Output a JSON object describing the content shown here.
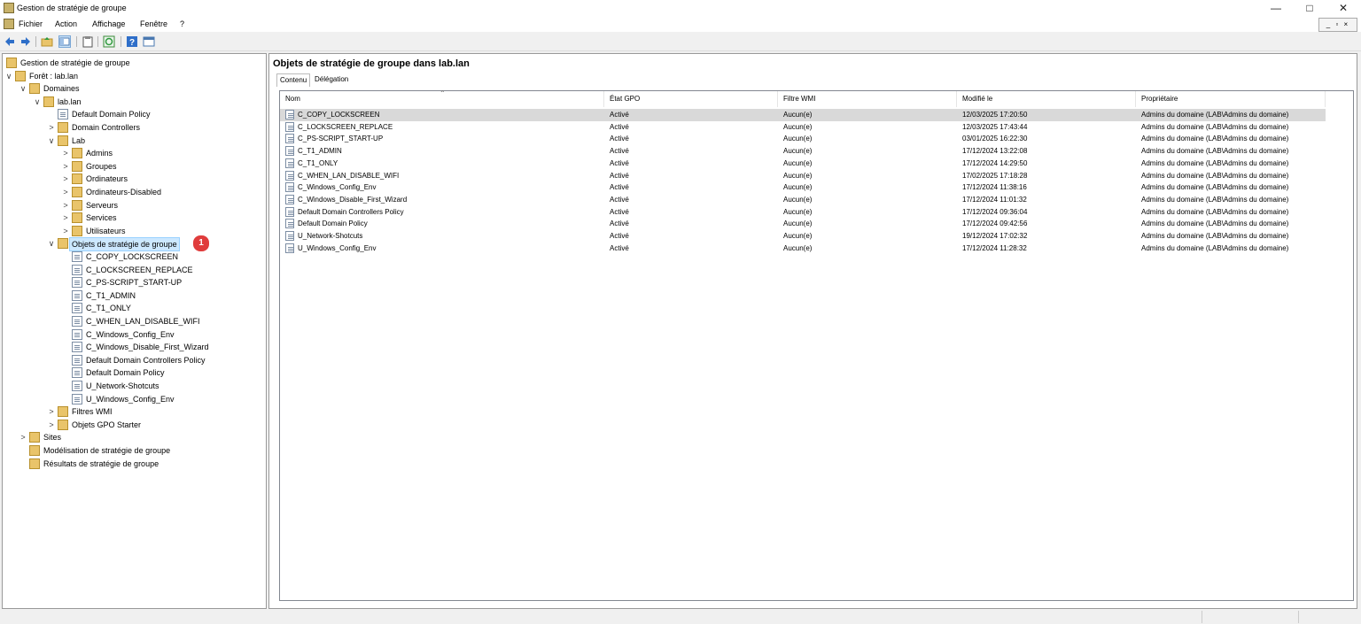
{
  "window": {
    "title": "Gestion de stratégie de groupe",
    "minimize": "—",
    "maximize": "□",
    "close": "✕"
  },
  "menu": [
    "Fichier",
    "Action",
    "Affichage",
    "Fenêtre",
    "?"
  ],
  "mdi_controls": "_ ▫ ×",
  "tree": [
    {
      "label": "Gestion de stratégie de groupe",
      "icon": "gpmc-icon",
      "arrow": ""
    },
    {
      "label": "Forêt : lab.lan",
      "icon": "forest-icon",
      "arrow": "∨"
    },
    {
      "label": "Domaines",
      "icon": "domains-icon",
      "arrow": "∨"
    },
    {
      "label": "lab.lan",
      "icon": "domain-icon",
      "arrow": "∨"
    },
    {
      "label": "Default Domain Policy",
      "icon": "gpo-link-icon",
      "arrow": ""
    },
    {
      "label": "Domain Controllers",
      "icon": "ou-icon",
      "arrow": ">"
    },
    {
      "label": "Lab",
      "icon": "ou-icon",
      "arrow": "∨"
    },
    {
      "label": "Admins",
      "icon": "ou-icon",
      "arrow": ">"
    },
    {
      "label": "Groupes",
      "icon": "ou-icon",
      "arrow": ">"
    },
    {
      "label": "Ordinateurs",
      "icon": "ou-icon",
      "arrow": ">"
    },
    {
      "label": "Ordinateurs-Disabled",
      "icon": "ou-icon",
      "arrow": ">"
    },
    {
      "label": "Serveurs",
      "icon": "ou-icon",
      "arrow": ">"
    },
    {
      "label": "Services",
      "icon": "ou-icon",
      "arrow": ">"
    },
    {
      "label": "Utilisateurs",
      "icon": "ou-icon",
      "arrow": ">"
    },
    {
      "label": "Objets de stratégie de groupe",
      "icon": "gpo-folder-icon",
      "arrow": "∨",
      "selected": true
    },
    {
      "label": "C_COPY_LOCKSCREEN",
      "icon": "gpo-icon",
      "arrow": ""
    },
    {
      "label": "C_LOCKSCREEN_REPLACE",
      "icon": "gpo-icon",
      "arrow": ""
    },
    {
      "label": "C_PS-SCRIPT_START-UP",
      "icon": "gpo-icon",
      "arrow": ""
    },
    {
      "label": "C_T1_ADMIN",
      "icon": "gpo-icon",
      "arrow": ""
    },
    {
      "label": "C_T1_ONLY",
      "icon": "gpo-icon",
      "arrow": ""
    },
    {
      "label": "C_WHEN_LAN_DISABLE_WIFI",
      "icon": "gpo-icon",
      "arrow": ""
    },
    {
      "label": "C_Windows_Config_Env",
      "icon": "gpo-icon",
      "arrow": ""
    },
    {
      "label": "C_Windows_Disable_First_Wizard",
      "icon": "gpo-icon",
      "arrow": ""
    },
    {
      "label": "Default Domain Controllers Policy",
      "icon": "gpo-icon",
      "arrow": ""
    },
    {
      "label": "Default Domain Policy",
      "icon": "gpo-icon",
      "arrow": ""
    },
    {
      "label": "U_Network-Shotcuts",
      "icon": "gpo-icon",
      "arrow": ""
    },
    {
      "label": "U_Windows_Config_Env",
      "icon": "gpo-icon",
      "arrow": ""
    },
    {
      "label": "Filtres WMI",
      "icon": "wmi-folder-icon",
      "arrow": ">"
    },
    {
      "label": "Objets GPO Starter",
      "icon": "starter-folder-icon",
      "arrow": ">"
    },
    {
      "label": "Sites",
      "icon": "sites-icon",
      "arrow": ">"
    },
    {
      "label": "Modélisation de stratégie de groupe",
      "icon": "modeling-icon",
      "arrow": ""
    },
    {
      "label": "Résultats de stratégie de groupe",
      "icon": "results-icon",
      "arrow": ""
    }
  ],
  "callout": "1",
  "pane": {
    "title": "Objets de stratégie de groupe dans lab.lan",
    "tabs": [
      "Contenu",
      "Délégation"
    ],
    "columns": [
      "Nom",
      "État GPO",
      "Filtre WMI",
      "Modifié le",
      "Propriétaire"
    ],
    "rows": [
      [
        "C_COPY_LOCKSCREEN",
        "Activé",
        "Aucun(e)",
        "12/03/2025 17:20:50",
        "Admins du domaine (LAB\\Admins du domaine)"
      ],
      [
        "C_LOCKSCREEN_REPLACE",
        "Activé",
        "Aucun(e)",
        "12/03/2025 17:43:44",
        "Admins du domaine (LAB\\Admins du domaine)"
      ],
      [
        "C_PS-SCRIPT_START-UP",
        "Activé",
        "Aucun(e)",
        "03/01/2025 16:22:30",
        "Admins du domaine (LAB\\Admins du domaine)"
      ],
      [
        "C_T1_ADMIN",
        "Activé",
        "Aucun(e)",
        "17/12/2024 13:22:08",
        "Admins du domaine (LAB\\Admins du domaine)"
      ],
      [
        "C_T1_ONLY",
        "Activé",
        "Aucun(e)",
        "17/12/2024 14:29:50",
        "Admins du domaine (LAB\\Admins du domaine)"
      ],
      [
        "C_WHEN_LAN_DISABLE_WIFI",
        "Activé",
        "Aucun(e)",
        "17/02/2025 17:18:28",
        "Admins du domaine (LAB\\Admins du domaine)"
      ],
      [
        "C_Windows_Config_Env",
        "Activé",
        "Aucun(e)",
        "17/12/2024 11:38:16",
        "Admins du domaine (LAB\\Admins du domaine)"
      ],
      [
        "C_Windows_Disable_First_Wizard",
        "Activé",
        "Aucun(e)",
        "17/12/2024 11:01:32",
        "Admins du domaine (LAB\\Admins du domaine)"
      ],
      [
        "Default Domain Controllers Policy",
        "Activé",
        "Aucun(e)",
        "17/12/2024 09:36:04",
        "Admins du domaine (LAB\\Admins du domaine)"
      ],
      [
        "Default Domain Policy",
        "Activé",
        "Aucun(e)",
        "17/12/2024 09:42:56",
        "Admins du domaine (LAB\\Admins du domaine)"
      ],
      [
        "U_Network-Shotcuts",
        "Activé",
        "Aucun(e)",
        "19/12/2024 17:02:32",
        "Admins du domaine (LAB\\Admins du domaine)"
      ],
      [
        "U_Windows_Config_Env",
        "Activé",
        "Aucun(e)",
        "17/12/2024 11:28:32",
        "Admins du domaine (LAB\\Admins du domaine)"
      ]
    ]
  },
  "colors": {
    "selection": "#cce8ff",
    "row_selected": "#d9d9d9",
    "badge": "#e03c3c",
    "folder": "#e9c46a"
  },
  "toolbar_icons": [
    "back-icon",
    "forward-icon",
    "up-folder-icon",
    "show-tree-icon",
    "properties-icon",
    "refresh-icon",
    "help-icon",
    "console-icon"
  ]
}
